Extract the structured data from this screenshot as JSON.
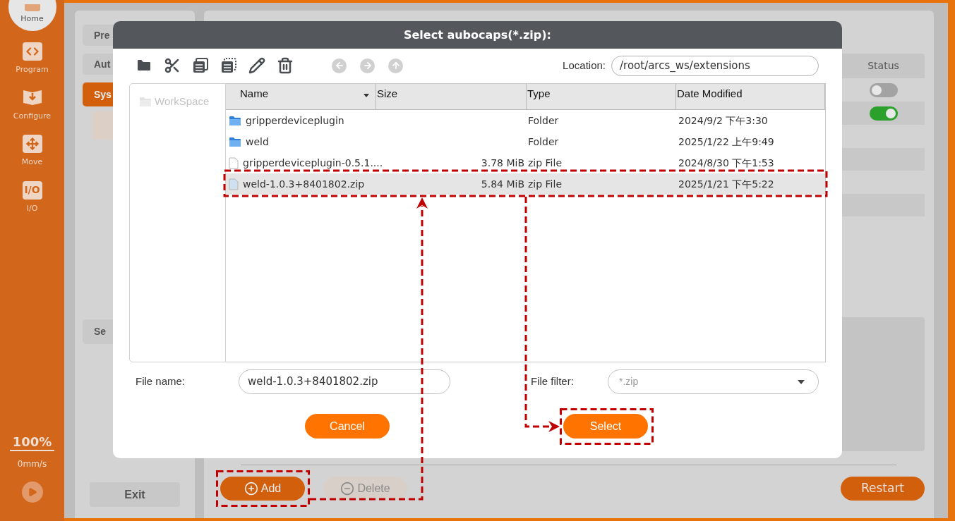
{
  "sidebar": {
    "items": [
      {
        "label": "Home",
        "kind": "home",
        "selected": true
      },
      {
        "label": "Program",
        "kind": "code",
        "selected": false
      },
      {
        "label": "Configure",
        "kind": "configure",
        "selected": false
      },
      {
        "label": "Move",
        "kind": "move",
        "selected": false
      },
      {
        "label": "I/O",
        "kind": "io",
        "icon_text": "I/O",
        "selected": false
      }
    ],
    "speed_percent": "100%",
    "speed": "0mm/s"
  },
  "settings_nav": {
    "items": [
      {
        "label": "Pre",
        "selected": false
      },
      {
        "label": "Aut",
        "selected": false
      },
      {
        "label": "Sys",
        "selected": true
      }
    ],
    "lower_items": [
      {
        "label": "Se",
        "selected": false
      }
    ],
    "exit_button": "Exit"
  },
  "extensions_table": {
    "columns": [
      "Status"
    ],
    "rows": [
      {
        "on": false
      },
      {
        "on": true
      }
    ]
  },
  "bottom_buttons": {
    "add": "Add",
    "delete": {
      "label": "Delete",
      "disabled": true
    },
    "restart": "Restart"
  },
  "dialog": {
    "title": "Select aubocaps(*.zip):",
    "navigation": [
      {
        "kind": "back",
        "disabled": true
      },
      {
        "kind": "forward",
        "disabled": true
      },
      {
        "kind": "up",
        "disabled": true
      }
    ],
    "location": {
      "label": "Location:",
      "value": "/root/arcs_ws/extensions"
    },
    "places": [
      {
        "label": "WorkSpace"
      }
    ],
    "file_table": {
      "columns": [
        {
          "label": "Name",
          "sorted": true
        },
        {
          "label": "Size",
          "sorted": false
        },
        {
          "label": "Type",
          "sorted": false
        },
        {
          "label": "Date Modified",
          "sorted": false
        }
      ],
      "rows": [
        {
          "kind": "folder",
          "name": "gripperdeviceplugin",
          "type": "Folder",
          "date": "2024/9/2 下午3:30",
          "selected": false
        },
        {
          "kind": "folder",
          "name": "weld",
          "type": "Folder",
          "date": "2025/1/22 上午9:49",
          "selected": false
        },
        {
          "kind": "file",
          "name": "gripperdeviceplugin-0.5.1....",
          "size": "3.78 MiB",
          "type": "zip File",
          "date": "2024/8/30 下午1:53",
          "selected": false
        },
        {
          "kind": "file",
          "name": "weld-1.0.3+8401802.zip",
          "size": "5.84 MiB",
          "type": "zip File",
          "date": "2025/1/21 下午5:22",
          "selected": true
        }
      ]
    },
    "file_name": {
      "label": "File name:",
      "value": "weld-1.0.3+8401802.zip"
    },
    "file_filter": {
      "label": "File filter:",
      "value": "*.zip"
    },
    "buttons": [
      "Cancel",
      "Select"
    ]
  }
}
